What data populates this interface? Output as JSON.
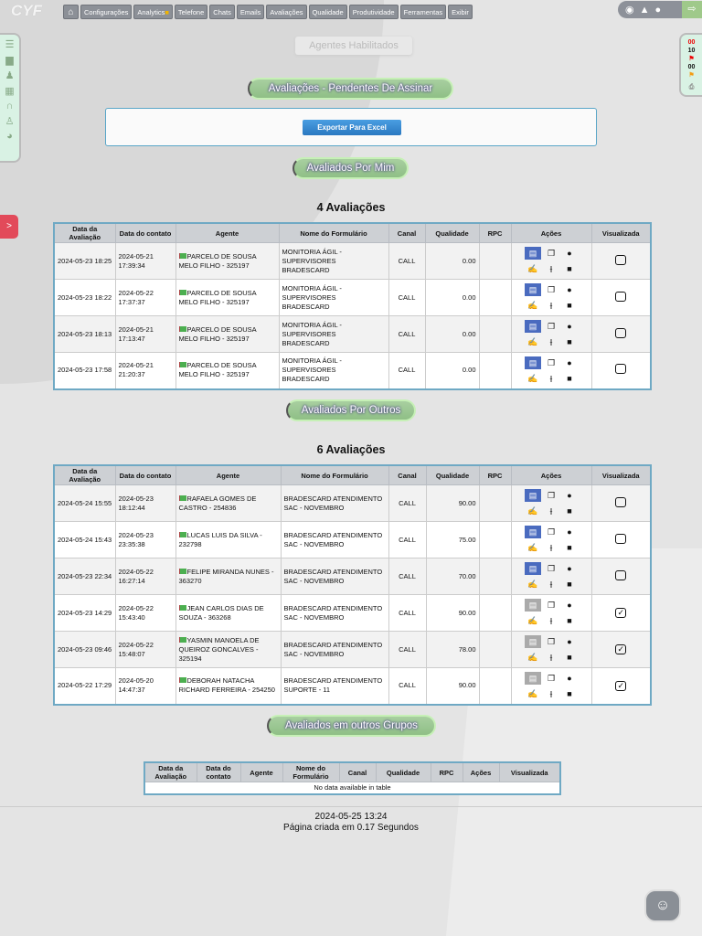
{
  "app": {
    "logo": "CYF"
  },
  "nav": [
    "Configurações",
    "Analytics",
    "Telefone",
    "Chats",
    "Emails",
    "Avaliações",
    "Qualidade",
    "Produtividade",
    "Ferramentas",
    "Exibir"
  ],
  "right_panel": {
    "v1": "00",
    "v2": "10",
    "v3": "00"
  },
  "side_tab": ">",
  "agentes_button": "Agentes Habilitados",
  "section1": {
    "title": "Avaliações - Pendentes De Assinar",
    "export": "Exportar Para Excel"
  },
  "section2": {
    "title": "Avaliados Por Mim",
    "count": "4 Avaliações"
  },
  "section3": {
    "title": "Avaliados Por Outros",
    "count": "6 Avaliações"
  },
  "section4": {
    "title": "Avaliados em outros Grupos",
    "empty": "No data available in table"
  },
  "headers": [
    "Data da Avaliação",
    "Data do contato",
    "Agente",
    "Nome do Formulário",
    "Canal",
    "Qualidade",
    "RPC",
    "Ações",
    "Visualizada"
  ],
  "table1": [
    {
      "aval": "2024-05-23 18:25",
      "contato": "2024-05-21 17:39:34",
      "agente": "PARCELO DE SOUSA MELO FILHO - 325197",
      "form": "MONITORIA ÁGIL - SUPERVISORES BRADESCARD",
      "canal": "CALL",
      "qual": "0.00",
      "rpc": "",
      "seen": false
    },
    {
      "aval": "2024-05-23 18:22",
      "contato": "2024-05-22 17:37:37",
      "agente": "PARCELO DE SOUSA MELO FILHO - 325197",
      "form": "MONITORIA ÁGIL - SUPERVISORES BRADESCARD",
      "canal": "CALL",
      "qual": "0.00",
      "rpc": "",
      "seen": false
    },
    {
      "aval": "2024-05-23 18:13",
      "contato": "2024-05-21 17:13:47",
      "agente": "PARCELO DE SOUSA MELO FILHO - 325197",
      "form": "MONITORIA ÁGIL - SUPERVISORES BRADESCARD",
      "canal": "CALL",
      "qual": "0.00",
      "rpc": "",
      "seen": false
    },
    {
      "aval": "2024-05-23 17:58",
      "contato": "2024-05-21 21:20:37",
      "agente": "PARCELO DE SOUSA MELO FILHO - 325197",
      "form": "MONITORIA ÁGIL - SUPERVISORES BRADESCARD",
      "canal": "CALL",
      "qual": "0.00",
      "rpc": "",
      "seen": false
    }
  ],
  "table2": [
    {
      "aval": "2024-05-24 15:55",
      "contato": "2024-05-23 18:12:44",
      "agente": "RAFAELA GOMES DE CASTRO - 254836",
      "form": "BRADESCARD ATENDIMENTO SAC - NOVEMBRO",
      "canal": "CALL",
      "qual": "90.00",
      "rpc": "",
      "seen": false
    },
    {
      "aval": "2024-05-24 15:43",
      "contato": "2024-05-23 23:35:38",
      "agente": "LUCAS LUIS DA SILVA - 232798",
      "form": "BRADESCARD ATENDIMENTO SAC - NOVEMBRO",
      "canal": "CALL",
      "qual": "75.00",
      "rpc": "",
      "seen": false
    },
    {
      "aval": "2024-05-23 22:34",
      "contato": "2024-05-22 16:27:14",
      "agente": "FELIPE MIRANDA NUNES - 363270",
      "form": "BRADESCARD ATENDIMENTO SAC - NOVEMBRO",
      "canal": "CALL",
      "qual": "70.00",
      "rpc": "",
      "seen": false
    },
    {
      "aval": "2024-05-23 14:29",
      "contato": "2024-05-22 15:43:40",
      "agente": "JEAN CARLOS DIAS DE SOUZA - 363268",
      "form": "BRADESCARD ATENDIMENTO SAC - NOVEMBRO",
      "canal": "CALL",
      "qual": "90.00",
      "rpc": "",
      "seen": true
    },
    {
      "aval": "2024-05-23 09:46",
      "contato": "2024-05-22 15:48:07",
      "agente": "YASMIN MANOELA DE QUEIROZ GONCALVES - 325194",
      "form": "BRADESCARD ATENDIMENTO SAC - NOVEMBRO",
      "canal": "CALL",
      "qual": "78.00",
      "rpc": "",
      "seen": true
    },
    {
      "aval": "2024-05-22 17:29",
      "contato": "2024-05-20 14:47:37",
      "agente": "DEBORAH NATACHA RICHARD FERREIRA - 254250",
      "form": "BRADESCARD ATENDIMENTO SUPORTE - 11",
      "canal": "CALL",
      "qual": "90.00",
      "rpc": "",
      "seen": true
    }
  ],
  "footer": {
    "timestamp": "2024-05-25 13:24",
    "generated": "Página criada em 0.17 Segundos"
  }
}
